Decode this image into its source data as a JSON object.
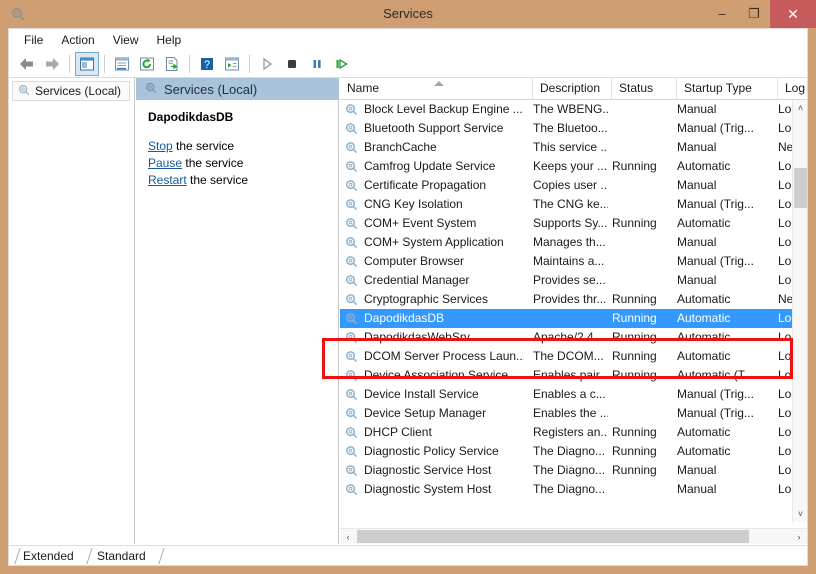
{
  "window": {
    "title": "Services",
    "icon": "services-gear-icon",
    "minimize_label": "–",
    "maximize_label": "❐",
    "close_label": "✕",
    "titlebar_color": "#cf9e72",
    "close_color": "#c75b5b"
  },
  "menu": {
    "items": [
      {
        "label": "File"
      },
      {
        "label": "Action"
      },
      {
        "label": "View"
      },
      {
        "label": "Help"
      }
    ]
  },
  "toolbar": {
    "buttons": [
      {
        "name": "back-icon",
        "glyph": "←"
      },
      {
        "name": "forward-icon",
        "glyph": "→"
      },
      {
        "name": "show-hide-tree-icon",
        "glyph": "▤",
        "active": true
      },
      {
        "name": "properties-icon",
        "glyph": "▥"
      },
      {
        "name": "refresh-icon",
        "glyph": "⟳"
      },
      {
        "name": "export-list-icon",
        "glyph": "≣"
      },
      {
        "name": "help-icon",
        "glyph": "?"
      },
      {
        "name": "console-view-icon",
        "glyph": "▦"
      },
      {
        "name": "start-service-icon",
        "glyph": "▶"
      },
      {
        "name": "stop-service-icon",
        "glyph": "■"
      },
      {
        "name": "pause-service-icon",
        "glyph": "▐▌"
      },
      {
        "name": "restart-service-icon",
        "glyph": "⏵"
      }
    ]
  },
  "tree": {
    "root_label": "Services (Local)",
    "icon": "services-gear-icon"
  },
  "details": {
    "header": "Services (Local)",
    "header_icon": "services-gear-icon",
    "service_name": "DapodikdasDB",
    "links": [
      {
        "action": "Stop",
        "suffix": " the service"
      },
      {
        "action": "Pause",
        "suffix": " the service"
      },
      {
        "action": "Restart",
        "suffix": " the service"
      }
    ],
    "link_color": "#16599e"
  },
  "list": {
    "columns": [
      {
        "key": "name",
        "label": "Name",
        "sorted": "asc"
      },
      {
        "key": "description",
        "label": "Description"
      },
      {
        "key": "status",
        "label": "Status"
      },
      {
        "key": "startup",
        "label": "Startup Type"
      },
      {
        "key": "logon",
        "label": "Log"
      }
    ],
    "selection_color": "#3399ff",
    "rows": [
      {
        "name": "Block Level Backup Engine ...",
        "description": "The WBENG...",
        "status": "",
        "startup": "Manual",
        "logon": "Loc",
        "selected": false
      },
      {
        "name": "Bluetooth Support Service",
        "description": "The Bluetoo...",
        "status": "",
        "startup": "Manual (Trig...",
        "logon": "Loc",
        "selected": false
      },
      {
        "name": "BranchCache",
        "description": "This service ...",
        "status": "",
        "startup": "Manual",
        "logon": "Net",
        "selected": false
      },
      {
        "name": "Camfrog Update Service",
        "description": "Keeps your ...",
        "status": "Running",
        "startup": "Automatic",
        "logon": "Loc",
        "selected": false
      },
      {
        "name": "Certificate Propagation",
        "description": "Copies user ...",
        "status": "",
        "startup": "Manual",
        "logon": "Loc",
        "selected": false
      },
      {
        "name": "CNG Key Isolation",
        "description": "The CNG ke...",
        "status": "",
        "startup": "Manual (Trig...",
        "logon": "Loc",
        "selected": false
      },
      {
        "name": "COM+ Event System",
        "description": "Supports Sy...",
        "status": "Running",
        "startup": "Automatic",
        "logon": "Loc",
        "selected": false
      },
      {
        "name": "COM+ System Application",
        "description": "Manages th...",
        "status": "",
        "startup": "Manual",
        "logon": "Loc",
        "selected": false
      },
      {
        "name": "Computer Browser",
        "description": "Maintains a...",
        "status": "",
        "startup": "Manual (Trig...",
        "logon": "Loc",
        "selected": false
      },
      {
        "name": "Credential Manager",
        "description": "Provides se...",
        "status": "",
        "startup": "Manual",
        "logon": "Loc",
        "selected": false
      },
      {
        "name": "Cryptographic Services",
        "description": "Provides thr...",
        "status": "Running",
        "startup": "Automatic",
        "logon": "Net",
        "selected": false
      },
      {
        "name": "DapodikdasDB",
        "description": "",
        "status": "Running",
        "startup": "Automatic",
        "logon": "Loc",
        "selected": true
      },
      {
        "name": "DapodikdasWebSrv",
        "description": "Apache/2.4....",
        "status": "Running",
        "startup": "Automatic",
        "logon": "Loc",
        "selected": false
      },
      {
        "name": "DCOM Server Process Laun...",
        "description": "The DCOM...",
        "status": "Running",
        "startup": "Automatic",
        "logon": "Loc",
        "selected": false
      },
      {
        "name": "Device Association Service",
        "description": "Enables pair...",
        "status": "Running",
        "startup": "Automatic (T...",
        "logon": "Loc",
        "selected": false
      },
      {
        "name": "Device Install Service",
        "description": "Enables a c...",
        "status": "",
        "startup": "Manual (Trig...",
        "logon": "Loc",
        "selected": false
      },
      {
        "name": "Device Setup Manager",
        "description": "Enables the ...",
        "status": "",
        "startup": "Manual (Trig...",
        "logon": "Loc",
        "selected": false
      },
      {
        "name": "DHCP Client",
        "description": "Registers an...",
        "status": "Running",
        "startup": "Automatic",
        "logon": "Loc",
        "selected": false
      },
      {
        "name": "Diagnostic Policy Service",
        "description": "The Diagno...",
        "status": "Running",
        "startup": "Automatic",
        "logon": "Loc",
        "selected": false
      },
      {
        "name": "Diagnostic Service Host",
        "description": "The Diagno...",
        "status": "Running",
        "startup": "Manual",
        "logon": "Loc",
        "selected": false
      },
      {
        "name": "Diagnostic System Host",
        "description": "The Diagno...",
        "status": "",
        "startup": "Manual",
        "logon": "Loc",
        "selected": false
      }
    ]
  },
  "scrollbars": {
    "v_up": "˄",
    "v_down": "˅",
    "h_left": "‹",
    "h_right": "›"
  },
  "tabs": {
    "items": [
      {
        "label": "Extended",
        "active": false
      },
      {
        "label": "Standard",
        "active": true
      }
    ]
  },
  "annotation": {
    "color": "#ee1111",
    "shape": "rectangle"
  }
}
